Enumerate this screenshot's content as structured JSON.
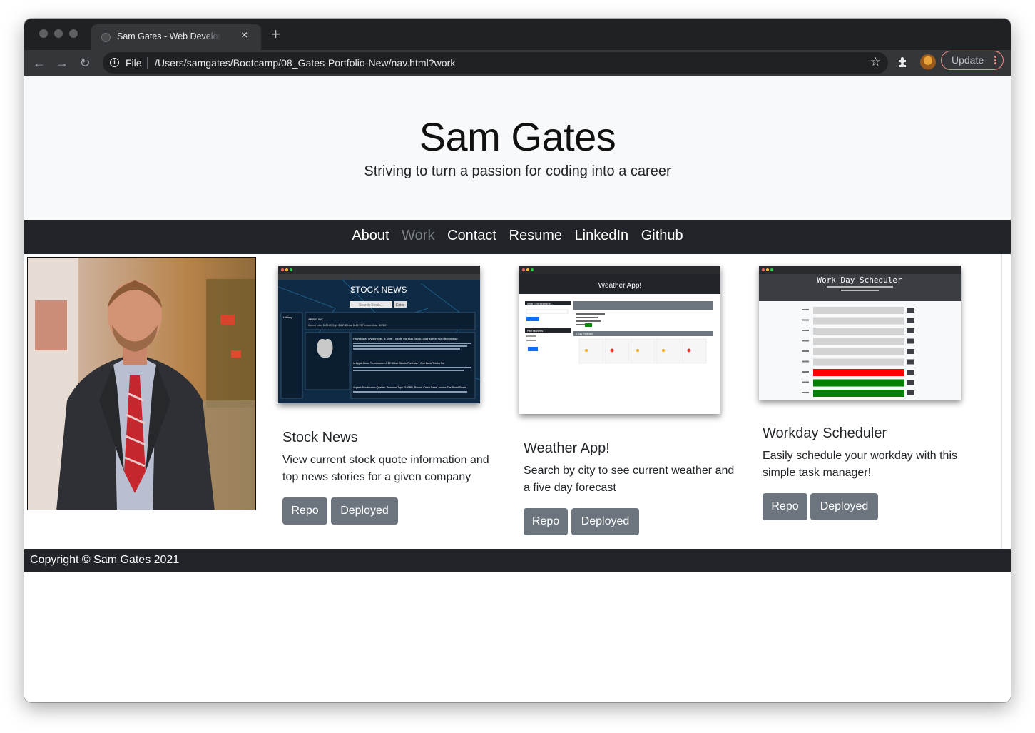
{
  "browser": {
    "tab_title": "Sam Gates - Web Developer Portfolio",
    "tab_close": "×",
    "new_tab": "+",
    "nav_back": "←",
    "nav_forward": "→",
    "nav_reload": "↻",
    "info_glyph": "i",
    "file_label": "File",
    "url": "/Users/samgates/Bootcamp/08_Gates-Portfolio-New/nav.html?work",
    "star_glyph": "☆",
    "update_label": "Update",
    "icons": [
      "info-icon",
      "star-icon",
      "extensions-icon",
      "profile-avatar",
      "more-icon"
    ]
  },
  "header": {
    "title": "Sam Gates",
    "subtitle": "Striving to turn a passion for coding into a career"
  },
  "nav": {
    "items": [
      {
        "label": "About",
        "active": false
      },
      {
        "label": "Work",
        "active": true
      },
      {
        "label": "Contact",
        "active": false
      },
      {
        "label": "Resume",
        "active": false
      },
      {
        "label": "LinkedIn",
        "active": false
      },
      {
        "label": "Github",
        "active": false
      }
    ]
  },
  "projects": [
    {
      "title": "Stock News",
      "description": "View current stock quote information and top news stories for a given company",
      "repo_label": "Repo",
      "deployed_label": "Deployed",
      "thumb": {
        "heading": "$TOCK NEWS",
        "search_placeholder": "Search Stock...",
        "enter": "Enter",
        "history": "History",
        "company": "APPLE INC",
        "price_line": "Current price: $121.39 High: $122.58 Low: $120.73 Previous close: $121.21",
        "headline_1": "HashMasks, CryptoPunks, & More... Inside The Multi-Billion-Dollar Market For Tokenized Art",
        "headline_2": "Is Apple About To Announce A $5 Billion Bitcoin Purchase? One Bank Thinks So",
        "headline_3": "Apple's Stockbuster Quarter: Revenue Tops $100BN, Record China Sales, Across The Board Beats"
      }
    },
    {
      "title": "Weather App!",
      "description": "Search by city to see current weather and a five day forecast",
      "repo_label": "Repo",
      "deployed_label": "Deployed",
      "thumb": {
        "heading": "Weather App!",
        "sidebar_prompt": "What's the weather in...",
        "past_searches": "Past searches",
        "five_day": "5 Day Forecast"
      }
    },
    {
      "title": "Workday Scheduler",
      "description": "Easily schedule your workday with this simple task manager!",
      "repo_label": "Repo",
      "deployed_label": "Deployed",
      "thumb": {
        "heading": "Work Day Scheduler",
        "row_states": [
          "past",
          "past",
          "past",
          "past",
          "past",
          "past",
          "present",
          "future",
          "future"
        ],
        "colors": {
          "past": "#d3d3d3",
          "present": "#ff0000",
          "future": "#008000"
        }
      }
    }
  ],
  "footer": {
    "copyright": "Copyright © Sam Gates 2021"
  },
  "colors": {
    "nav_bg": "#212529",
    "jumbotron_bg": "#f8f9fa",
    "button_bg": "#6c757d",
    "nav_active": "#7c8086"
  }
}
